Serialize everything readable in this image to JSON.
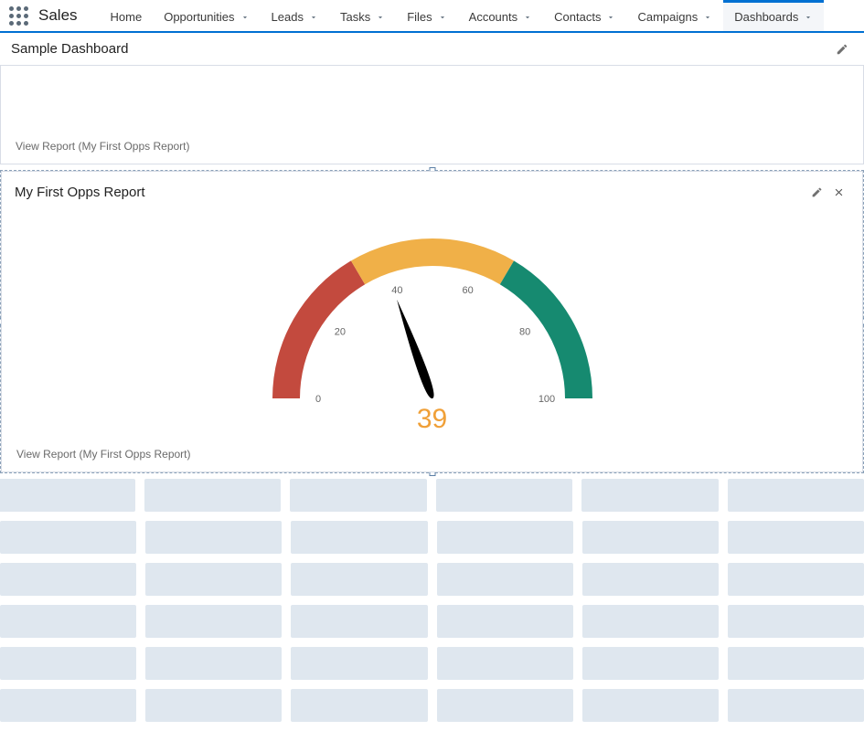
{
  "app": {
    "name": "Sales"
  },
  "nav": {
    "items": [
      {
        "label": "Home",
        "dropdown": false
      },
      {
        "label": "Opportunities",
        "dropdown": true
      },
      {
        "label": "Leads",
        "dropdown": true
      },
      {
        "label": "Tasks",
        "dropdown": true
      },
      {
        "label": "Files",
        "dropdown": true
      },
      {
        "label": "Accounts",
        "dropdown": true
      },
      {
        "label": "Contacts",
        "dropdown": true
      },
      {
        "label": "Campaigns",
        "dropdown": true
      },
      {
        "label": "Dashboards",
        "dropdown": true,
        "active": true
      }
    ]
  },
  "dashboard": {
    "title": "Sample Dashboard"
  },
  "widget1": {
    "view_link": "View Report (My First Opps Report)"
  },
  "widget2": {
    "title": "My First Opps Report",
    "view_link": "View Report (My First Opps Report)"
  },
  "chart_data": {
    "type": "gauge",
    "min": 0,
    "max": 100,
    "value": 39,
    "ticks": [
      0,
      20,
      40,
      60,
      80,
      100
    ],
    "segments": [
      {
        "from": 0,
        "to": 33,
        "color": "#c34a3e"
      },
      {
        "from": 33,
        "to": 67,
        "color": "#f0b048"
      },
      {
        "from": 67,
        "to": 100,
        "color": "#168a70"
      }
    ],
    "value_color": "#f0a038"
  }
}
